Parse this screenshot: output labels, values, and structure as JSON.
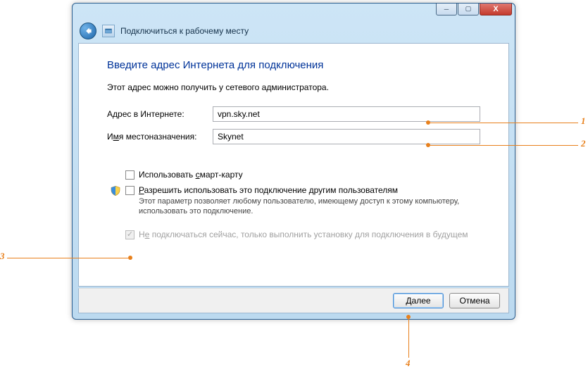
{
  "window": {
    "header_title": "Подключиться к рабочему месту"
  },
  "content": {
    "title": "Введите адрес Интернета для подключения",
    "subtext": "Этот адрес можно получить у сетевого администратора.",
    "address_label_pre": "А",
    "address_label_u": "д",
    "address_label_post": "рес в Интернете:",
    "address_value": "vpn.sky.net",
    "dest_label_pre": "И",
    "dest_label_u": "м",
    "dest_label_post": "я местоназначения:",
    "dest_value": "Skynet",
    "smartcard_pre": "Использовать ",
    "smartcard_u": "с",
    "smartcard_post": "март-карту",
    "allow_pre": "",
    "allow_u": "Р",
    "allow_post": "азрешить использовать это подключение другим пользователям",
    "allow_help": "Этот параметр позволяет любому пользователю, имеющему доступ к этому компьютеру, использовать это подключение.",
    "noconnect_pre": "Н",
    "noconnect_u": "е",
    "noconnect_post": " подключаться сейчас, только выполнить установку для подключения в будущем"
  },
  "footer": {
    "next_pre": "",
    "next_u": "Д",
    "next_post": "алее",
    "cancel": "Отмена"
  },
  "annotations": {
    "a1": "1",
    "a2": "2",
    "a3": "3",
    "a4": "4"
  }
}
